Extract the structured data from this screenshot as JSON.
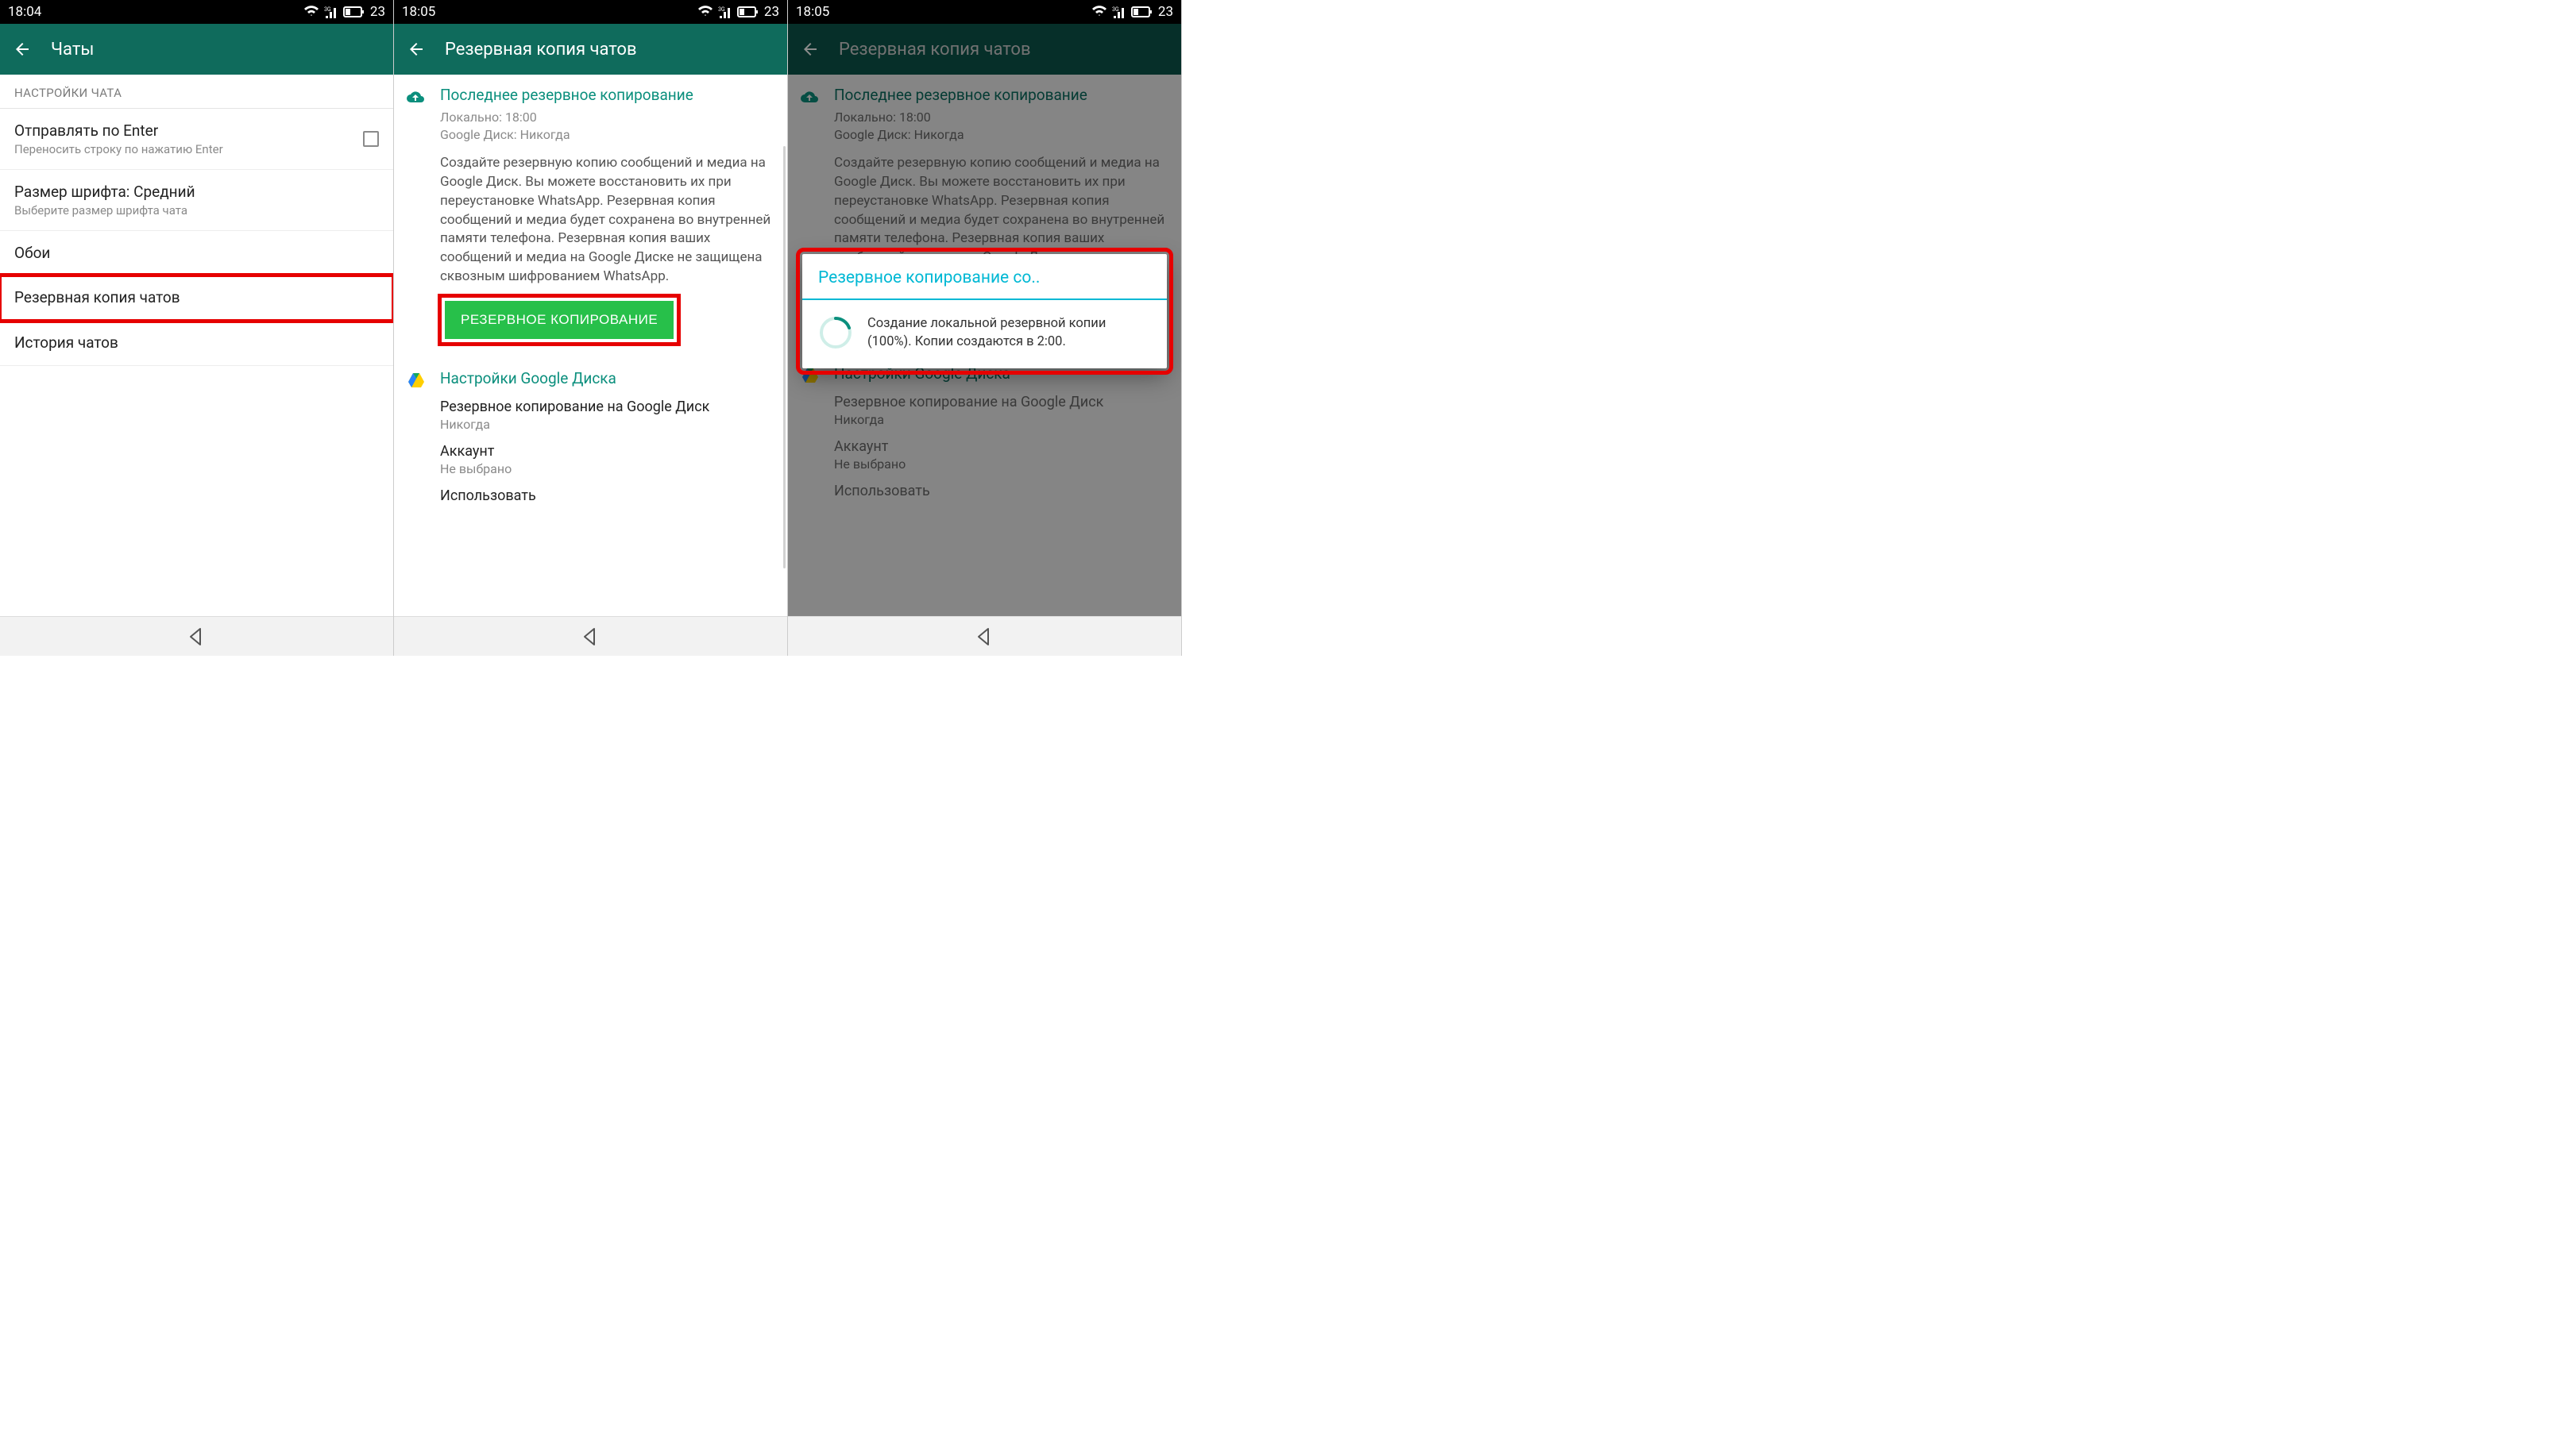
{
  "screen1": {
    "status": {
      "time": "18:04",
      "battery": "23"
    },
    "title": "Чаты",
    "section_header": "НАСТРОЙКИ ЧАТА",
    "items": {
      "enter": {
        "title": "Отправлять по Enter",
        "sub": "Переносить строку по нажатию Enter"
      },
      "font": {
        "title": "Размер шрифта: Средний",
        "sub": "Выберите размер шрифта чата"
      },
      "wallpaper": {
        "title": "Обои"
      },
      "backup": {
        "title": "Резервная копия чатов"
      },
      "history": {
        "title": "История чатов"
      }
    }
  },
  "screen2": {
    "status": {
      "time": "18:05",
      "battery": "23"
    },
    "title": "Резервная копия чатов",
    "last_backup_heading": "Последнее резервное копирование",
    "local_line": "Локально: 18:00",
    "gdrive_line": "Google Диск: Никогда",
    "description": "Создайте резервную копию сообщений и медиа на Google Диск. Вы можете восстановить их при переустановке WhatsApp. Резервная копия сообщений и медиа будет сохранена во внутренней памяти телефона. Резервная копия ваших сообщений и медиа на Google Диске не защищена сквозным шифрованием WhatsApp.",
    "backup_button": "РЕЗЕРВНОЕ КОПИРОВАНИЕ",
    "gdrive_heading": "Настройки Google Диска",
    "settings": {
      "freq": {
        "title": "Резервное копирование на Google Диск",
        "sub": "Никогда"
      },
      "account": {
        "title": "Аккаунт",
        "sub": "Не выбрано"
      },
      "use": {
        "title": "Использовать"
      }
    }
  },
  "screen3": {
    "status": {
      "time": "18:05",
      "battery": "23"
    },
    "title": "Резервная копия чатов",
    "dialog": {
      "title": "Резервное копирование со..",
      "body": "Создание локальной резервной копии (100%). Копии создаются в 2:00."
    }
  }
}
